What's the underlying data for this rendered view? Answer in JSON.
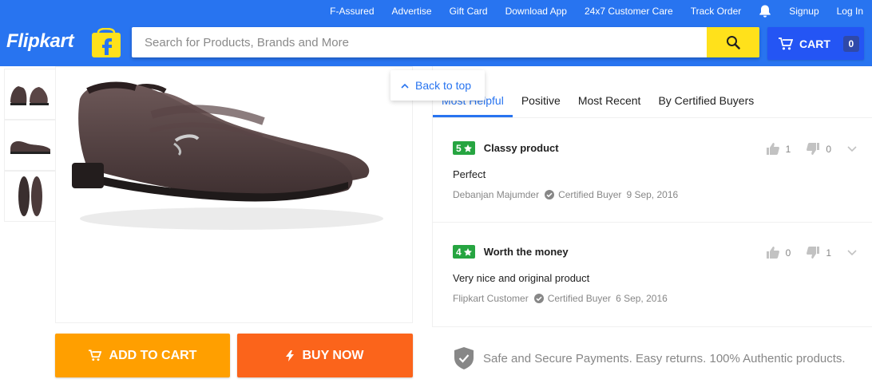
{
  "header": {
    "top_links": [
      "F-Assured",
      "Advertise",
      "Gift Card",
      "Download App",
      "24x7 Customer Care",
      "Track Order"
    ],
    "bell_icon": "bell-icon",
    "signup": "Signup",
    "login": "Log In",
    "logo_text": "Flipkart",
    "search_placeholder": "Search for Products, Brands and More",
    "cart_label": "CART",
    "cart_count": "0"
  },
  "colors": {
    "brand_blue": "#2874f0",
    "search_yellow": "#ffe11b",
    "add_to_cart_orange": "#ff9f00",
    "buy_now_orange": "#fb641b",
    "rating_green": "#26a541"
  },
  "product": {
    "thumbnails": [
      "shoe-pair-front",
      "shoe-side",
      "shoe-soles"
    ]
  },
  "actions": {
    "add_to_cart": "ADD TO CART",
    "buy_now": "BUY NOW"
  },
  "back_to_top": "Back to top",
  "reviews": {
    "tabs": [
      "Most Helpful",
      "Positive",
      "Most Recent",
      "By Certified Buyers"
    ],
    "active_tab": "Most Helpful",
    "items": [
      {
        "rating": "5",
        "title": "Classy product",
        "body": "Perfect",
        "author": "Debanjan Majumder",
        "badge": "Certified Buyer",
        "date": "9 Sep, 2016",
        "likes": "1",
        "dislikes": "0"
      },
      {
        "rating": "4",
        "title": "Worth the money",
        "body": "Very nice and original product",
        "author": "Flipkart Customer",
        "badge": "Certified Buyer",
        "date": "6 Sep, 2016",
        "likes": "0",
        "dislikes": "1"
      }
    ]
  },
  "trust": {
    "text": "Safe and Secure Payments. Easy returns. 100% Authentic products."
  }
}
